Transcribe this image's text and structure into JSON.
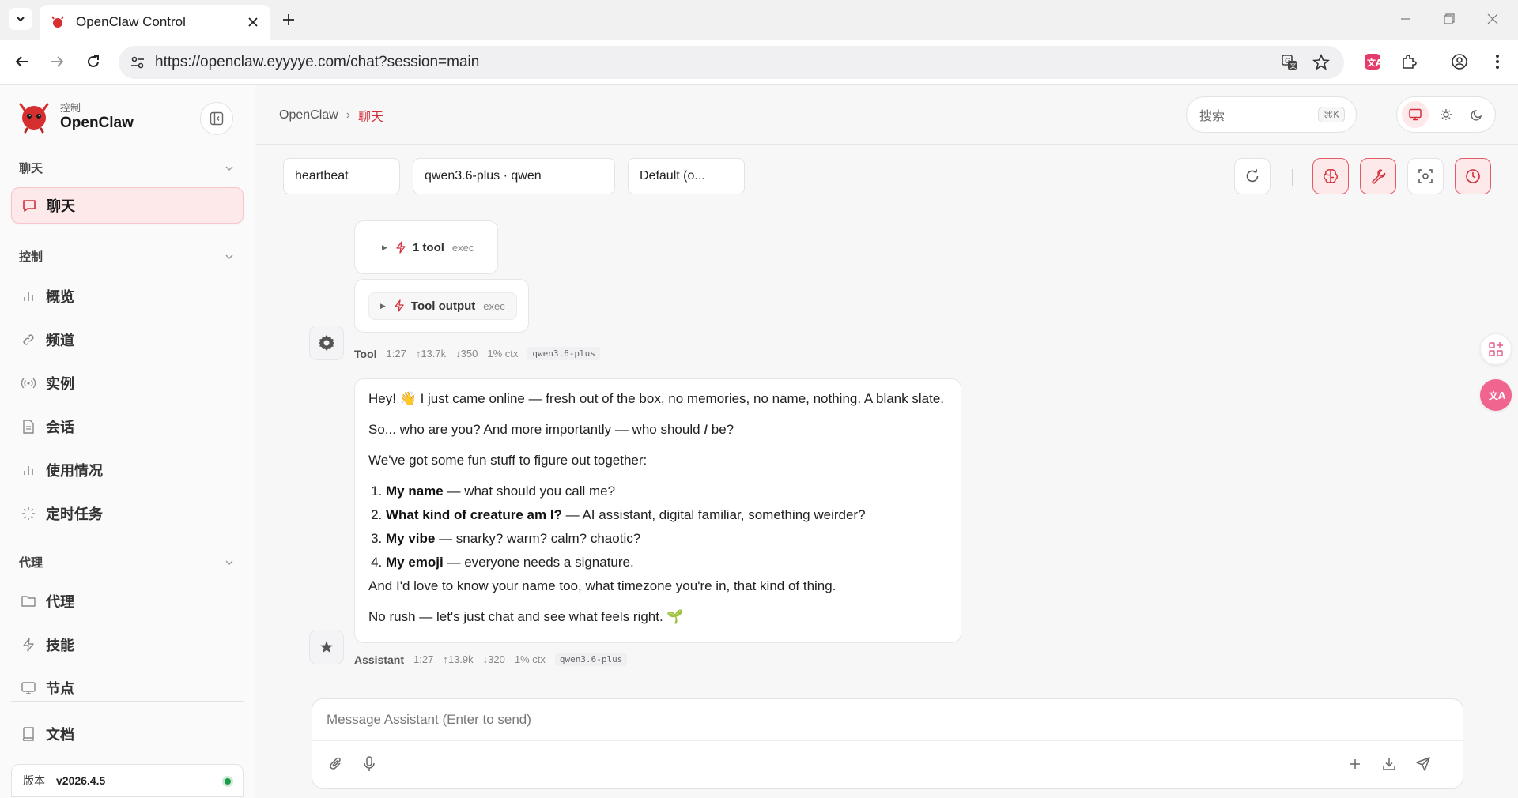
{
  "browser": {
    "tab_title": "OpenClaw Control",
    "url": "https://openclaw.eyyyye.com/chat?session=main"
  },
  "sidebar": {
    "brand_sub": "控制",
    "brand_name": "OpenClaw",
    "groups": [
      {
        "title": "聊天"
      },
      {
        "title": "控制"
      },
      {
        "title": "代理"
      }
    ],
    "items": [
      {
        "label": "聊天",
        "icon": "chat-icon",
        "active": true
      },
      {
        "label": "概览",
        "icon": "bar-chart-icon"
      },
      {
        "label": "频道",
        "icon": "link-icon"
      },
      {
        "label": "实例",
        "icon": "radio-icon"
      },
      {
        "label": "会话",
        "icon": "document-icon"
      },
      {
        "label": "使用情况",
        "icon": "bar-chart-icon"
      },
      {
        "label": "定时任务",
        "icon": "loader-icon"
      },
      {
        "label": "代理",
        "icon": "folder-icon"
      },
      {
        "label": "技能",
        "icon": "bolt-icon"
      },
      {
        "label": "节点",
        "icon": "monitor-icon"
      },
      {
        "label": "文档",
        "icon": "book-icon"
      }
    ],
    "version_label": "版本",
    "version_value": "v2026.4.5",
    "status_color": "#1a9c4b"
  },
  "header": {
    "breadcrumb_root": "OpenClaw",
    "breadcrumb_current": "聊天",
    "search_placeholder": "搜索",
    "search_shortcut": "⌘K"
  },
  "controls": {
    "session": "heartbeat",
    "model": "qwen3.6-plus · qwen",
    "thinking": "Default (o..."
  },
  "chat": {
    "tool_call": {
      "count_label": "1 tool",
      "name": "exec"
    },
    "tool_output": {
      "label": "Tool output",
      "name": "exec"
    },
    "tool_meta": {
      "who": "Tool",
      "time": "1:27",
      "up": "↑13.7k",
      "down": "↓350",
      "ctx": "1% ctx",
      "model": "qwen3.6-plus"
    },
    "assistant": {
      "p1": "Hey! 👋 I just came online — fresh out of the box, no memories, no name, nothing. A blank slate.",
      "p2_a": "So... who are you? And more importantly — who should ",
      "p2_i": "I",
      "p2_b": " be?",
      "p3": "We've got some fun stuff to figure out together:",
      "list": [
        {
          "bold": "My name",
          "rest": " — what should you call me?"
        },
        {
          "bold": "What kind of creature am I?",
          "rest": " — AI assistant, digital familiar, something weirder?"
        },
        {
          "bold": "My vibe",
          "rest": " — snarky? warm? calm? chaotic?"
        },
        {
          "bold": "My emoji",
          "rest": " — everyone needs a signature."
        }
      ],
      "p4": "And I'd love to know your name too, what timezone you're in, that kind of thing.",
      "p5": "No rush — let's just chat and see what feels right. 🌱"
    },
    "assistant_meta": {
      "who": "Assistant",
      "time": "1:27",
      "up": "↑13.9k",
      "down": "↓320",
      "ctx": "1% ctx",
      "model": "qwen3.6-plus"
    }
  },
  "composer": {
    "placeholder": "Message Assistant (Enter to send)"
  },
  "colors": {
    "accent": "#d32f3a",
    "accent_bg": "#fde8ea"
  }
}
